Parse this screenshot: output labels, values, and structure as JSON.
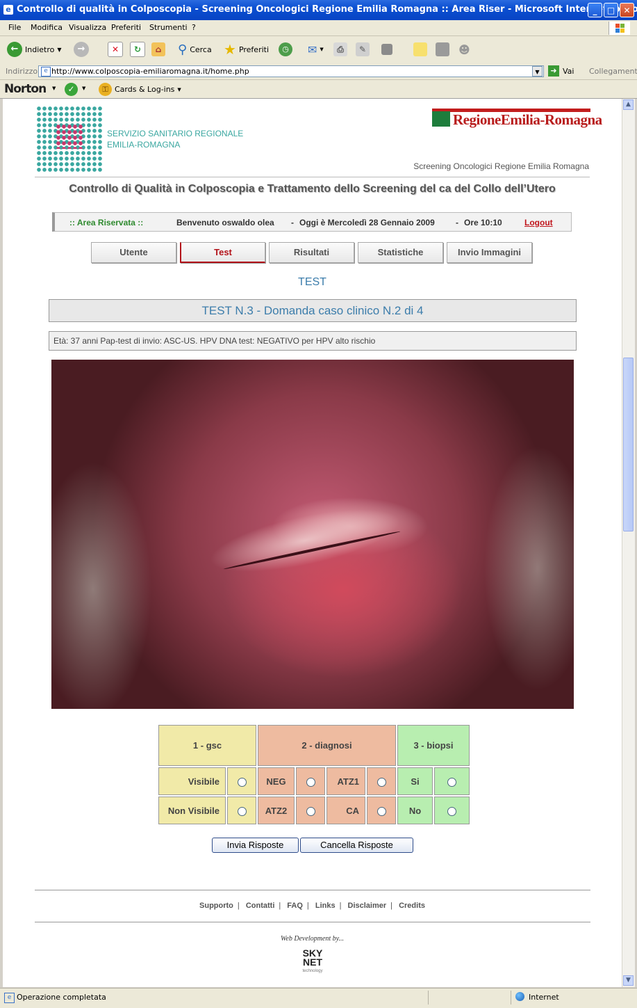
{
  "window": {
    "title": "Controllo di qualità in Colposcopia - Screening Oncologici Regione Emilia Romagna :: Area Riser - Microsoft Internet Explorer",
    "min": "_",
    "max": "□",
    "close": "✕"
  },
  "menu": [
    "File",
    "Modifica",
    "Visualizza",
    "Preferiti",
    "Strumenti",
    "?"
  ],
  "toolbar": {
    "back": "Indietro",
    "search": "Cerca",
    "favorites": "Preferiti"
  },
  "address": {
    "label": "Indirizzo",
    "url": "http://www.colposcopia-emiliaromagna.it/home.php",
    "go": "Vai",
    "links": "Collegamenti"
  },
  "norton": {
    "brand": "Norton",
    "cards": "Cards & Log-ins"
  },
  "header": {
    "ssr_line1": "SERVIZIO SANITARIO REGIONALE",
    "ssr_line2": "EMILIA-ROMAGNA",
    "rer": "RegioneEmilia-Romagna",
    "subtitle": "Screening Oncologici Regione Emilia Romagna",
    "title": "Controllo di Qualità in Colposcopia e Trattamento dello Screening del ca del Collo dell’Utero"
  },
  "area": {
    "label": ":: Area Riservata ::",
    "welcome": "Benvenuto oswaldo olea",
    "date": "Oggi è Mercoledì 28 Gennaio 2009",
    "time": "Ore 10:10",
    "logout": "Logout",
    "sep": "-"
  },
  "tabs": [
    "Utente",
    "Test",
    "Risultati",
    "Statistiche",
    "Invio Immagini"
  ],
  "section_title": "TEST",
  "test_title": "TEST N.3 - Domanda caso clinico N.2 di 4",
  "case_info": "Età: 37 anni Pap-test di invio: ASC-US. HPV DNA test: NEGATIVO per HPV alto rischio",
  "answers": {
    "headers": [
      "1 - gsc",
      "2 - diagnosi",
      "3 - biopsi"
    ],
    "gsc": [
      "Visibile",
      "Non Visibile"
    ],
    "diagnosi": [
      "NEG",
      "ATZ1",
      "ATZ2",
      "CA"
    ],
    "biopsi": [
      "Si",
      "No"
    ]
  },
  "buttons": {
    "submit": "Invia Risposte",
    "reset": "Cancella Risposte"
  },
  "footer": {
    "links": [
      "Supporto",
      "Contatti",
      "FAQ",
      "Links",
      "Disclaimer",
      "Credits"
    ],
    "sep": "|",
    "webdev": "Web Development by...",
    "sky": "SKY",
    "net": "NET",
    "tech": "technology"
  },
  "status": {
    "text": "Operazione completata",
    "zone": "Internet"
  }
}
